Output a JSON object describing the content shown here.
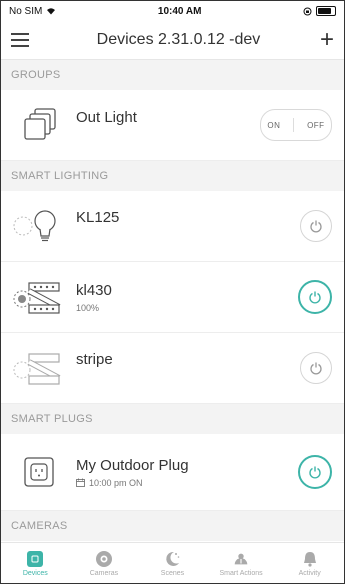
{
  "status": {
    "carrier": "No SIM",
    "time": "10:40 AM"
  },
  "header": {
    "title": "Devices 2.31.0.12 -dev"
  },
  "groups": {
    "label": "GROUPS",
    "items": [
      {
        "name": "Out Light",
        "toggle_on": "ON",
        "toggle_off": "OFF"
      }
    ]
  },
  "smart_lighting": {
    "label": "SMART LIGHTING",
    "items": [
      {
        "name": "KL125",
        "state": "off"
      },
      {
        "name": "kl430",
        "sub": "100%",
        "state": "on"
      },
      {
        "name": "stripe",
        "state": "off"
      }
    ]
  },
  "smart_plugs": {
    "label": "SMART PLUGS",
    "items": [
      {
        "name": "My Outdoor Plug",
        "schedule": "10:00 pm ON",
        "state": "on"
      }
    ]
  },
  "cameras": {
    "label": "CAMERAS"
  },
  "tabs": [
    {
      "label": "Devices",
      "icon": "devices-icon",
      "active": true
    },
    {
      "label": "Cameras",
      "icon": "camera-icon",
      "active": false
    },
    {
      "label": "Scenes",
      "icon": "scenes-icon",
      "active": false
    },
    {
      "label": "Smart Actions",
      "icon": "smart-actions-icon",
      "active": false
    },
    {
      "label": "Activity",
      "icon": "bell-icon",
      "active": false
    }
  ],
  "colors": {
    "accent": "#3db4a8",
    "section_bg": "#f3f3f3"
  }
}
